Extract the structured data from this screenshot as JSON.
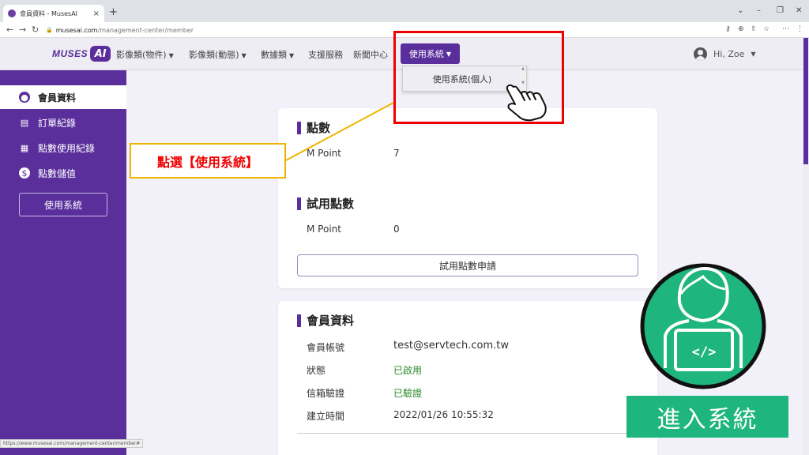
{
  "browser": {
    "tab_title": "會員資料 - MusesAI",
    "tab_close": "×",
    "new_tab": "+",
    "url_host": "musesai.com",
    "url_path": "/management-center/member",
    "status_url": "https://www.musesai.com/management-center/member#"
  },
  "header": {
    "logo_text": "MUSES",
    "logo_badge": "AI",
    "nav": [
      {
        "label": "影像類(物件)",
        "dropdown": true
      },
      {
        "label": "影像類(動態)",
        "dropdown": true
      },
      {
        "label": "數據類",
        "dropdown": true
      },
      {
        "label": "支援服務",
        "dropdown": false
      },
      {
        "label": "新聞中心",
        "dropdown": false
      }
    ],
    "use_system_label": "使用系統",
    "user_label": "Hi, Zoe"
  },
  "dropdown": {
    "items": [
      "使用系統(個人)"
    ]
  },
  "sidebar": {
    "items": [
      {
        "label": "會員資料",
        "icon": "user-circle-icon",
        "active": true
      },
      {
        "label": "訂單紀錄",
        "icon": "document-icon",
        "active": false
      },
      {
        "label": "點數使用紀錄",
        "icon": "record-icon",
        "active": false
      },
      {
        "label": "點數儲值",
        "icon": "coin-icon",
        "active": false
      }
    ],
    "button_label": "使用系統"
  },
  "points": {
    "title": "點數",
    "label": "M Point",
    "value": "7"
  },
  "trial": {
    "title": "試用點數",
    "label": "M Point",
    "value": "0",
    "apply_label": "試用點數申請"
  },
  "member": {
    "title": "會員資料",
    "rows": [
      {
        "label": "會員帳號",
        "value": "test@servtech.com.tw"
      },
      {
        "label": "狀態",
        "value": "已啟用"
      },
      {
        "label": "信箱驗證",
        "value": "已驗證"
      },
      {
        "label": "建立時間",
        "value": "2022/01/26 10:55:32"
      }
    ]
  },
  "annotations": {
    "callout": "點選【使用系統】",
    "banner": "進入系統",
    "accent_red": "#e00000",
    "accent_yellow": "#f0b400",
    "accent_green": "#1fb57f"
  },
  "colors": {
    "brand_purple": "#5a2e9b",
    "status_green": "#2c8a2c"
  }
}
